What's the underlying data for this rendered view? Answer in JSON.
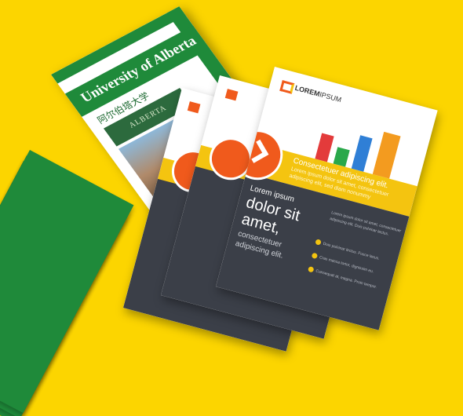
{
  "brochure": {
    "title": "University of Alberta",
    "subtitle": "阿尔伯塔大学",
    "sign": "ALBERTA"
  },
  "flyer": {
    "logo_text_bold": "LOREM",
    "logo_text_light": "IPSUM",
    "yellow_heading": "Consectetuer adipiscing elit.",
    "yellow_lines": [
      "Lorem ipsum dolor sit amet, consectetuer",
      "adipiscing elit, sed diam nonummy"
    ],
    "headline_small": "Lorem ipsum",
    "headline_line1": "dolor sit",
    "headline_line2": "amet,",
    "headline_line3": "consectetuer",
    "headline_line4": "adipiscing elit.",
    "body_lines": [
      "Lorem ipsum dolor sit amet, consectetuer",
      "adipiscing elit. Duis pulvinar lectus."
    ],
    "bullets": [
      "Duis pulvinar lectus. Fusce lacus.",
      "Cras massa tortor, dignissim eu.",
      "Consequat at, magna. Proin tempor."
    ]
  },
  "colors": {
    "background": "#fcd500",
    "university_green": "#1f8a3a",
    "flyer_orange": "#f05a1c",
    "flyer_yellow": "#f4c410",
    "flyer_dark": "#3b3f48"
  }
}
